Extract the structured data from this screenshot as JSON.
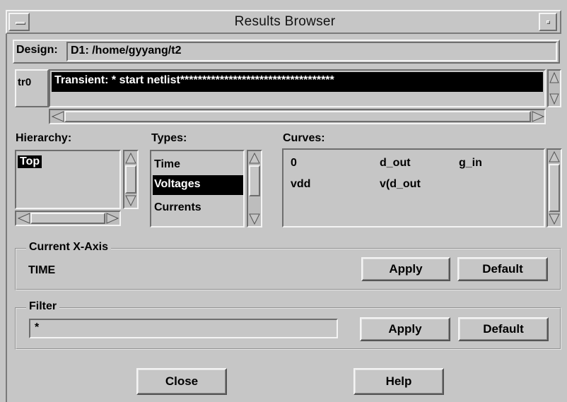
{
  "window": {
    "title": "Results Browser"
  },
  "design": {
    "label": "Design:",
    "value": "D1: /home/gyyang/t2"
  },
  "run": {
    "id": "tr0",
    "description": "Transient: * start netlist***********************************"
  },
  "hierarchy": {
    "label": "Hierarchy:",
    "items": [
      "Top"
    ],
    "selected": "Top"
  },
  "types": {
    "label": "Types:",
    "items": [
      "Time",
      "Voltages",
      "Currents"
    ],
    "selected": "Voltages"
  },
  "curves": {
    "label": "Curves:",
    "items": [
      "0",
      "d_out",
      "g_in",
      "vdd",
      "v(d_out"
    ]
  },
  "xaxis": {
    "label": "Current X-Axis",
    "value": "TIME",
    "apply_label": "Apply",
    "default_label": "Default"
  },
  "filter": {
    "label": "Filter",
    "value": "*",
    "apply_label": "Apply",
    "default_label": "Default"
  },
  "footer": {
    "close_label": "Close",
    "help_label": "Help"
  },
  "colors": {
    "background": "#c6c6c6",
    "selection": "#000000",
    "selection_text": "#ffffff"
  }
}
